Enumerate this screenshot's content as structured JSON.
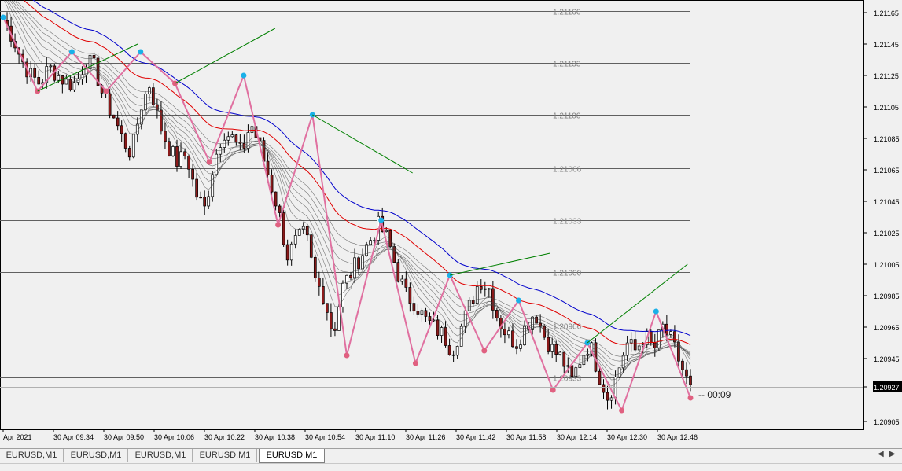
{
  "window": {
    "symbol_timeframe": "EURUSD,M1"
  },
  "tabs": [
    {
      "label": "EURUSD,M1",
      "active": false
    },
    {
      "label": "EURUSD,M1",
      "active": false
    },
    {
      "label": "EURUSD,M1",
      "active": false
    },
    {
      "label": "EURUSD,M1",
      "active": false
    },
    {
      "label": "EURUSD,M1",
      "active": true
    }
  ],
  "colors": {
    "background": "#f0f0f0",
    "bull_candle": "#000000",
    "bear_candle": "#8b1a1a",
    "red_ma": "#e00000",
    "blue_ma": "#0000cc",
    "ribbon": "#404040",
    "zigzag": "#e070a0",
    "swing_high_dot": "#1ab0e8",
    "swing_low_dot": "#e06080",
    "trendline": "#008000",
    "level_line": "#606060",
    "bid_line": "#b0b0b0"
  },
  "chart_data": {
    "type": "candlestick",
    "instrument": "EURUSD",
    "timeframe": "M1",
    "y_axis_labels": [
      "1.21165",
      "1.21145",
      "1.21125",
      "1.21105",
      "1.21085",
      "1.21065",
      "1.21045",
      "1.21025",
      "1.21005",
      "1.20985",
      "1.20965",
      "1.20945",
      "1.20927",
      "1.20905"
    ],
    "y_axis_values": [
      1.21165,
      1.21145,
      1.21125,
      1.21105,
      1.21085,
      1.21065,
      1.21045,
      1.21025,
      1.21005,
      1.20985,
      1.20965,
      1.20945,
      1.20905
    ],
    "ylim": [
      1.209,
      1.2117
    ],
    "current_price_label": "1.20927",
    "current_price": 1.20927,
    "countdown": "00:09",
    "x_tick_labels": [
      "Apr 2021",
      "30 Apr 09:34",
      "30 Apr 09:50",
      "30 Apr 10:06",
      "30 Apr 10:22",
      "30 Apr 10:38",
      "30 Apr 10:54",
      "30 Apr 11:10",
      "30 Apr 11:26",
      "30 Apr 11:42",
      "30 Apr 11:58",
      "30 Apr 12:14",
      "30 Apr 12:30",
      "30 Apr 12:46"
    ],
    "price_levels": [
      {
        "label": "1.21166",
        "value": 1.21166
      },
      {
        "label": "1.21133",
        "value": 1.21133
      },
      {
        "label": "1.21100",
        "value": 1.211
      },
      {
        "label": "1.21066",
        "value": 1.21066
      },
      {
        "label": "1.21033",
        "value": 1.21033
      },
      {
        "label": "1.21000",
        "value": 1.21
      },
      {
        "label": "1.20966",
        "value": 1.20966
      },
      {
        "label": "1.20933",
        "value": 1.20933
      }
    ],
    "zigzag": [
      1.21162,
      1.21115,
      1.2114,
      1.21115,
      1.2114,
      1.2112,
      1.2107,
      1.21125,
      1.2103,
      1.211,
      1.20947,
      1.21033,
      1.20942,
      1.20998,
      1.2095,
      1.20982,
      1.20925,
      1.20955,
      1.20912,
      1.20975,
      1.2092
    ],
    "swing_highs": [
      1.21162,
      1.2114,
      1.2114,
      1.21125,
      1.211,
      1.21033,
      1.20998,
      1.20982,
      1.20955,
      1.20975
    ],
    "swing_lows": [
      1.21115,
      1.21115,
      1.2107,
      1.2103,
      1.20947,
      1.20942,
      1.2095,
      1.20925,
      1.20912,
      1.2092
    ],
    "close_path": [
      1.2116,
      1.2115,
      1.21135,
      1.21125,
      1.2112,
      1.2113,
      1.21125,
      1.2112,
      1.2112,
      1.21135,
      1.2113,
      1.2111,
      1.211,
      1.21085,
      1.21075,
      1.21105,
      1.2112,
      1.21095,
      1.2108,
      1.2107,
      1.21075,
      1.2105,
      1.2104,
      1.2107,
      1.2109,
      1.21085,
      1.21075,
      1.21095,
      1.2108,
      1.2106,
      1.2104,
      1.2101,
      1.2102,
      1.21025,
      1.20995,
      1.20985,
      1.2096,
      1.2099,
      1.21,
      1.2101,
      1.2102,
      1.2103,
      1.2102,
      1.21,
      1.20985,
      1.2098,
      1.2097,
      1.20965,
      1.2096,
      1.2095,
      1.20965,
      1.2098,
      1.20995,
      1.2099,
      1.2097,
      1.2096,
      1.20955,
      1.20965,
      1.20975,
      1.2096,
      1.2095,
      1.20945,
      1.2093,
      1.20945,
      1.20955,
      1.20935,
      1.2092,
      1.20935,
      1.20955,
      1.2095,
      1.2096,
      1.2095,
      1.20965,
      1.20955,
      1.2094,
      1.20925
    ]
  }
}
